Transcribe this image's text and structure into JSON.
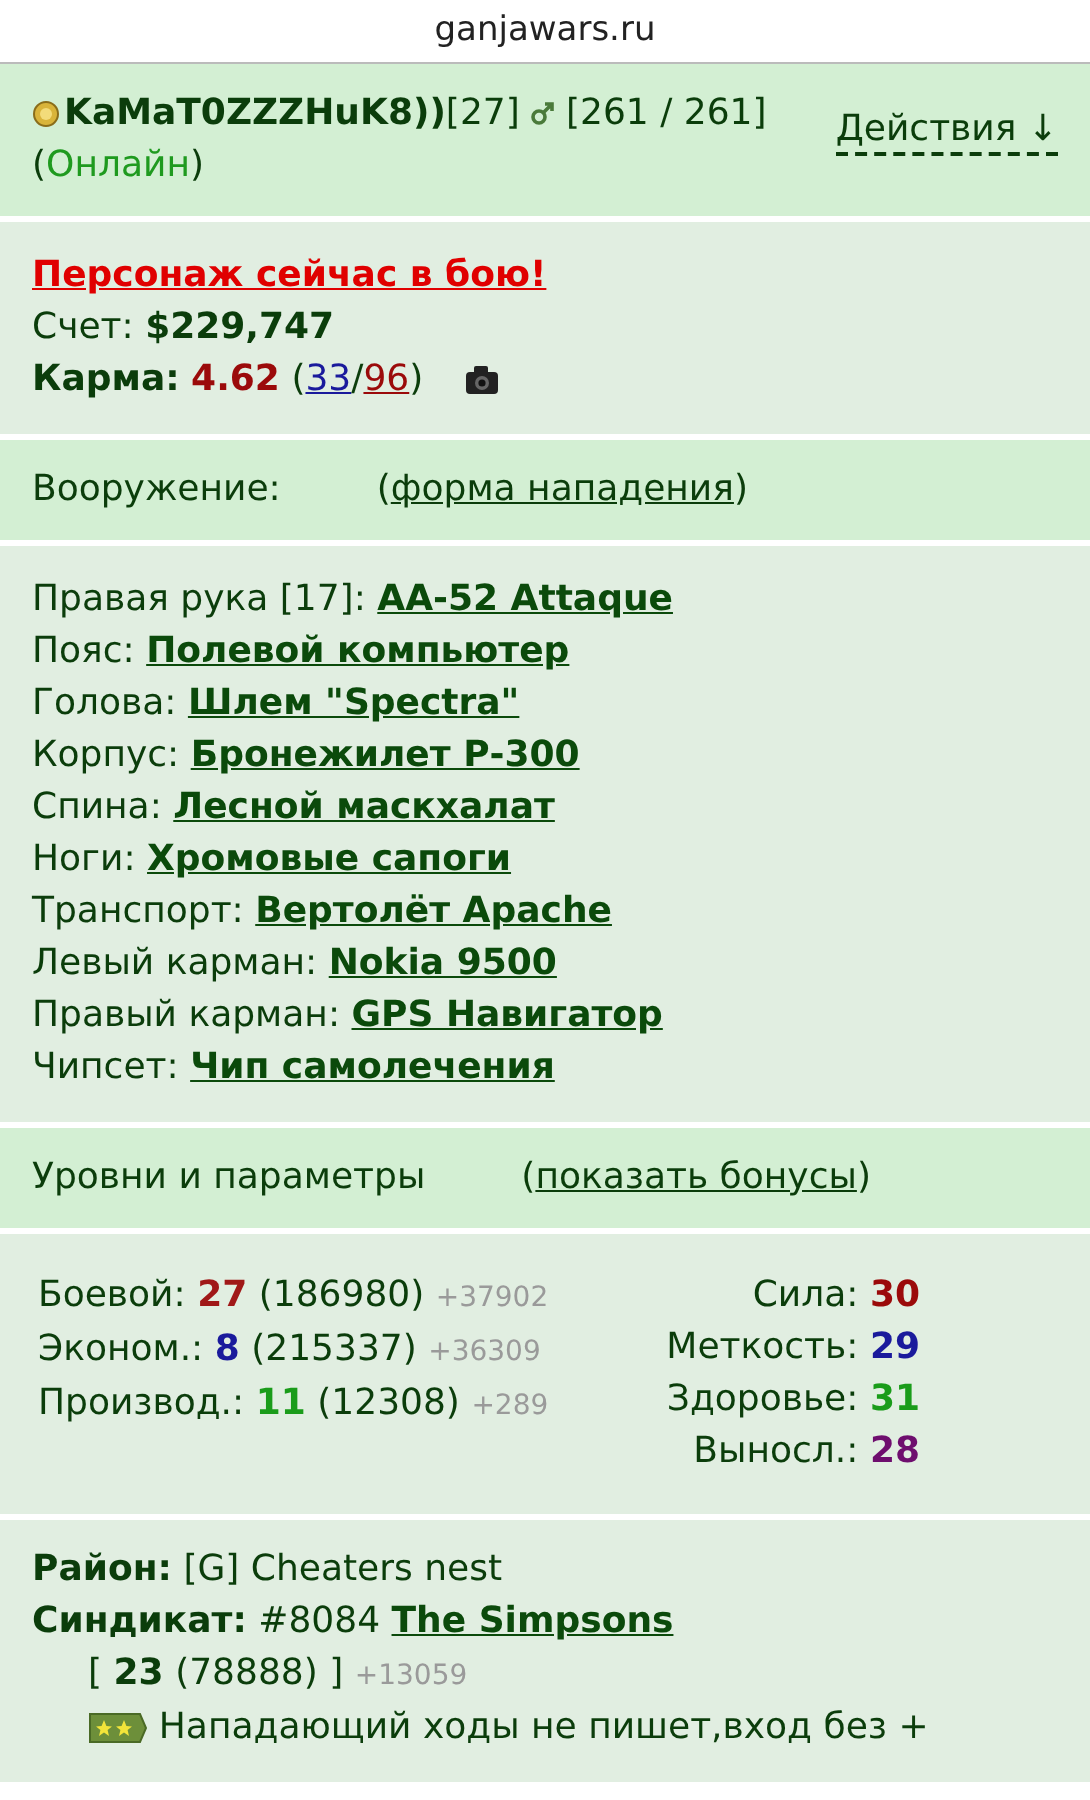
{
  "site": "ganjawars.ru",
  "player": {
    "name": "KaMaT0ZZZHuK8))",
    "level": "[27]",
    "hp": "[261 / 261]",
    "status_open": "(",
    "status": "Онлайн",
    "status_close": ")",
    "actions": "Действия ↓"
  },
  "summary": {
    "alert": "Персонаж сейчас в бою!",
    "score_label": "Счет:",
    "score": "$229,747",
    "karma_label": "Карма:",
    "karma": "4.62",
    "karma_open": "(",
    "karma_plus": "33",
    "karma_sep": "/",
    "karma_minus": "96",
    "karma_close": ")"
  },
  "weapons_heading": {
    "label": "Вооружение:",
    "open": "(",
    "link": "форма нападения",
    "close": ")"
  },
  "equipment": [
    {
      "slot": "Правая рука [17]:",
      "item": "АА-52 Attaque"
    },
    {
      "slot": "Пояс:",
      "item": "Полевой компьютер"
    },
    {
      "slot": "Голова:",
      "item": "Шлем \"Spectra\""
    },
    {
      "slot": "Корпус:",
      "item": "Бронежилет Р-300"
    },
    {
      "slot": "Спина:",
      "item": "Лесной маскхалат"
    },
    {
      "slot": "Ноги:",
      "item": "Хромовые сапоги"
    },
    {
      "slot": "Транспорт:",
      "item": "Вертолёт Apache"
    },
    {
      "slot": "Левый карман:",
      "item": "Nokia 9500"
    },
    {
      "slot": "Правый карман:",
      "item": "GPS Навигатор"
    },
    {
      "slot": "Чипсет:",
      "item": "Чип самолечения"
    }
  ],
  "levels_heading": {
    "label": "Уровни и параметры",
    "open": "(",
    "link": "показать бонусы",
    "close": ")"
  },
  "skills": [
    {
      "label": "Боевой:",
      "level": "27",
      "color": "#a01818",
      "exp": "(186980)",
      "delta": "+37902"
    },
    {
      "label": "Эконом.:",
      "level": "8",
      "color": "#1a1a9c",
      "exp": "(215337)",
      "delta": "+36309"
    },
    {
      "label": "Производ.:",
      "level": "11",
      "color": "#1a9c1a",
      "exp": "(12308)",
      "delta": "+289"
    }
  ],
  "attributes": [
    {
      "label": "Сила:",
      "value": "30",
      "color": "#9b0a0a"
    },
    {
      "label": "Меткость:",
      "value": "29",
      "color": "#1a1a9c"
    },
    {
      "label": "Здоровье:",
      "value": "31",
      "color": "#1a9c1a"
    },
    {
      "label": "Выносл.:",
      "value": "28",
      "color": "#6e0e6e"
    }
  ],
  "district": {
    "label": "Район:",
    "value": "[G] Cheaters nest"
  },
  "syndicate": {
    "label": "Синдикат:",
    "number": "#8084",
    "name": "The Simpsons",
    "open": "[",
    "level": "23",
    "exp": "(78888)",
    "close": "]",
    "delta": "+13059",
    "note": "Нападающий ходы не пишет,вход без +"
  }
}
